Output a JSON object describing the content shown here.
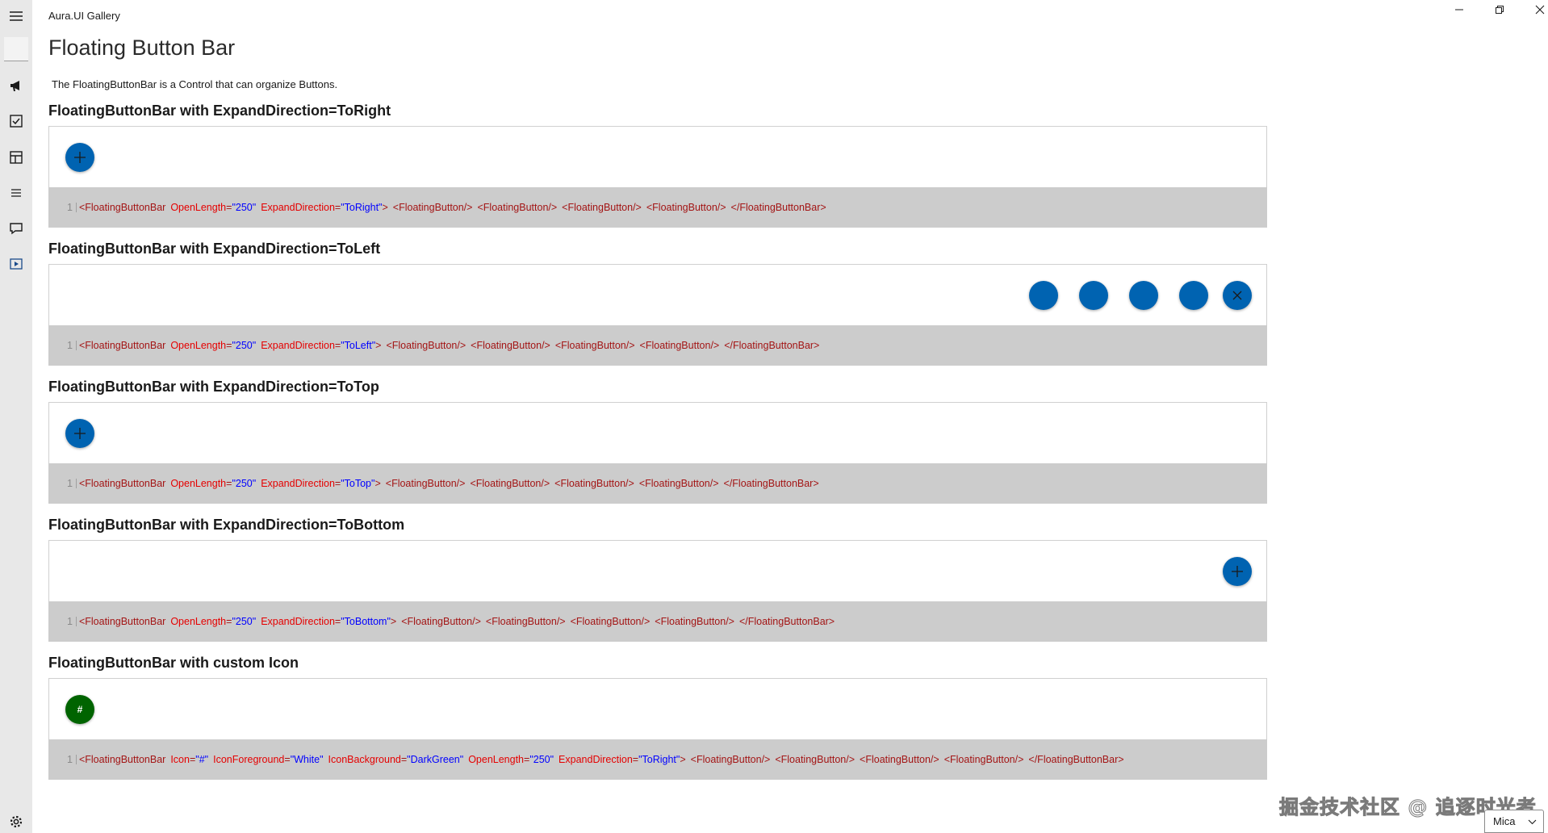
{
  "window": {
    "title": "Aura.UI Gallery",
    "controls": [
      "minimize-icon",
      "restore-icon",
      "close-icon"
    ]
  },
  "nav": {
    "icons": [
      "hamburger-icon",
      "blank-selected",
      "megaphone-icon",
      "checkbox-icon",
      "layout-icon",
      "list-icon",
      "message-icon",
      "media-icon"
    ],
    "settings_icon": "gear-icon"
  },
  "page": {
    "title": "Floating Button Bar",
    "description": "The FloatingButtonBar is a Control that can organize Buttons."
  },
  "sections": [
    {
      "title": "FloatingButtonBar with ExpandDirection=ToRight",
      "line": "1",
      "code_attrs": [
        {
          "name": "OpenLength",
          "value": "\"250\""
        },
        {
          "name": "ExpandDirection",
          "value": "\"ToRight\""
        }
      ]
    },
    {
      "title": "FloatingButtonBar with ExpandDirection=ToLeft",
      "line": "1",
      "code_attrs": [
        {
          "name": "OpenLength",
          "value": "\"250\""
        },
        {
          "name": "ExpandDirection",
          "value": "\"ToLeft\""
        }
      ]
    },
    {
      "title": "FloatingButtonBar with ExpandDirection=ToTop",
      "line": "1",
      "code_attrs": [
        {
          "name": "OpenLength",
          "value": "\"250\""
        },
        {
          "name": "ExpandDirection",
          "value": "\"ToTop\""
        }
      ]
    },
    {
      "title": "FloatingButtonBar with ExpandDirection=ToBottom",
      "line": "1",
      "code_attrs": [
        {
          "name": "OpenLength",
          "value": "\"250\""
        },
        {
          "name": "ExpandDirection",
          "value": "\"ToBottom\""
        }
      ]
    },
    {
      "title": "FloatingButtonBar with custom Icon",
      "line": "1",
      "code_attrs": [
        {
          "name": "Icon",
          "value": "\"#\""
        },
        {
          "name": "IconForeground",
          "value": "\"White\""
        },
        {
          "name": "IconBackground",
          "value": "\"DarkGreen\""
        },
        {
          "name": "OpenLength",
          "value": "\"250\""
        },
        {
          "name": "ExpandDirection",
          "value": "\"ToRight\""
        }
      ],
      "icon_glyph": "#"
    }
  ],
  "code_tokens": {
    "open": "<FloatingButtonBar",
    "close_open": ">",
    "child": "<FloatingButton/>",
    "close": "</FloatingButtonBar>",
    "equals": "="
  },
  "theme_selector": {
    "value": "Mica"
  },
  "watermark": "掘金技术社区 @ 追逐时光者",
  "colors": {
    "accent": "#0063b1",
    "custom_icon_bg": "#006400",
    "code_bg": "#cccccc",
    "rail_bg": "#e8e8e8"
  }
}
